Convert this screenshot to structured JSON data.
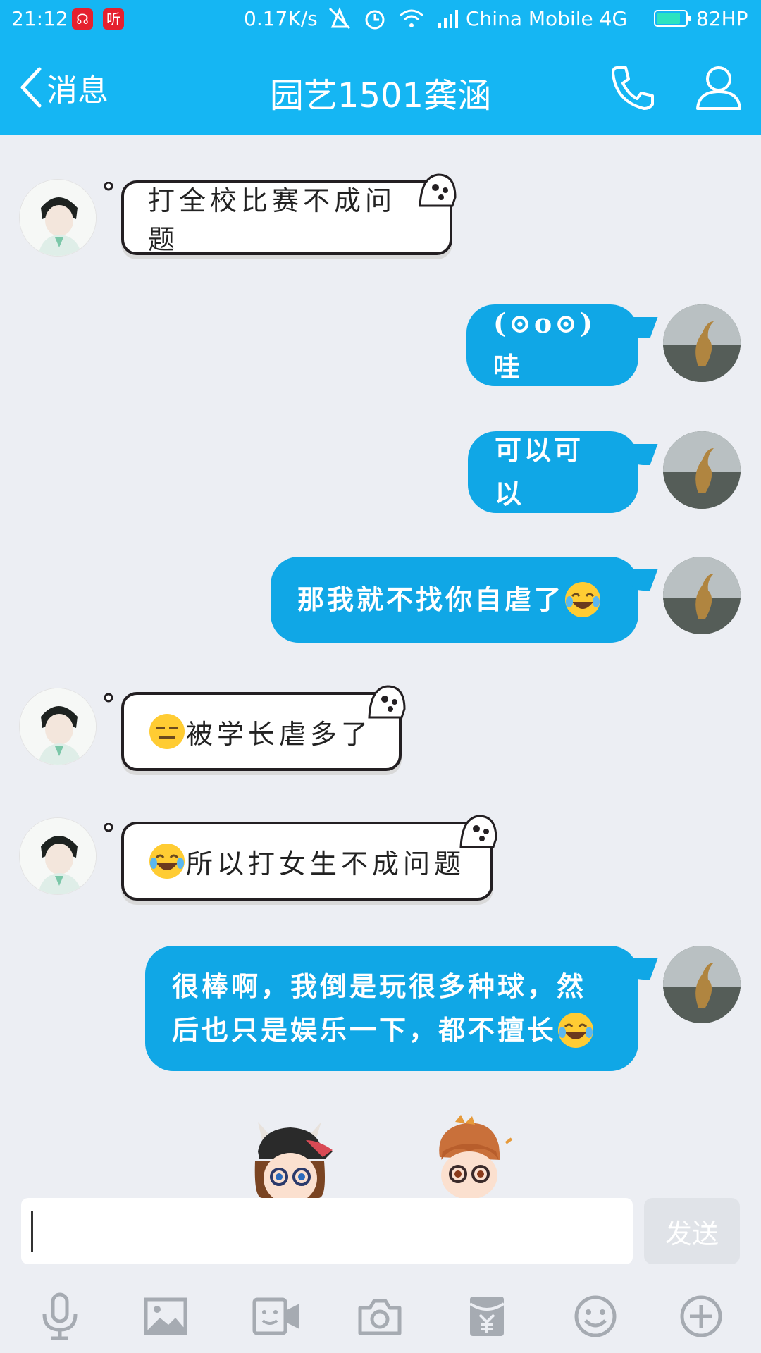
{
  "status_bar": {
    "time": "21:12",
    "app_badge_1": "☊",
    "app_badge_2": "听",
    "net_speed": "0.17K/s",
    "carrier": "China Mobile 4G",
    "battery_level": 0.82,
    "battery_text": "82HP"
  },
  "header": {
    "back_label": "消息",
    "title": "园艺1501龚涵"
  },
  "messages": [
    {
      "sender": "friend",
      "text": "打全校比赛不成问题",
      "emoji_before": ""
    },
    {
      "sender": "me",
      "text": "(⊙o⊙)哇",
      "emoji_after": ""
    },
    {
      "sender": "me",
      "text": "可以可以",
      "emoji_after": ""
    },
    {
      "sender": "me",
      "text": "那我就不找你自虐了",
      "emoji_after": "joy"
    },
    {
      "sender": "friend",
      "text": "被学长虐多了",
      "emoji_before": "expressionless"
    },
    {
      "sender": "friend",
      "text": "所以打女生不成问题",
      "emoji_before": "joy"
    },
    {
      "sender": "me",
      "line1": "很棒啊，我倒是玩很多种球，然",
      "line2": "后也只是娱乐一下，都不擅长",
      "emoji_after": "joy"
    }
  ],
  "input": {
    "placeholder": "",
    "value": "",
    "send_label": "发送"
  },
  "toolbar": [
    "microphone-icon",
    "image-icon",
    "video-call-icon",
    "camera-icon",
    "red-packet-icon",
    "emoji-icon",
    "plus-icon"
  ],
  "colors": {
    "brand": "#15B6F3",
    "my_bubble": "#10A7E6",
    "background": "#ECEEF3"
  }
}
